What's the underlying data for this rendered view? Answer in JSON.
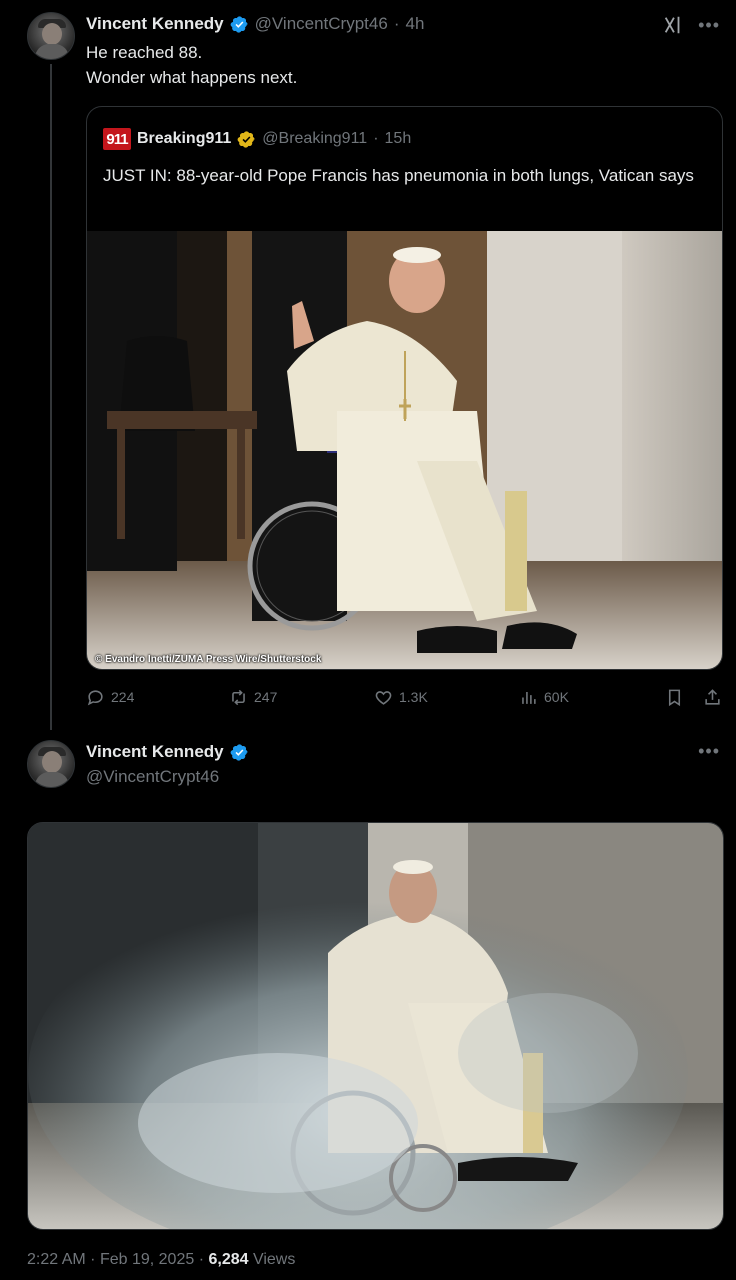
{
  "tweet": {
    "author_name": "Vincent Kennedy",
    "author_handle": "@VincentCrypt46",
    "time_ago": "4h",
    "text_line1": "He reached 88.",
    "text_line2": "Wonder what happens next."
  },
  "quoted": {
    "logo_text": "911",
    "author_name": "Breaking911",
    "author_handle": "@Breaking911",
    "time_ago": "15h",
    "text": "JUST IN: 88-year-old Pope Francis has pneumonia in both lungs, Vatican says",
    "image_credit": "© Evandro Inetti/ZUMA Press Wire/Shutterstock"
  },
  "actions": {
    "replies": "224",
    "reposts": "247",
    "likes": "1.3K",
    "views": "60K"
  },
  "reply": {
    "author_name": "Vincent Kennedy",
    "author_handle": "@VincentCrypt46"
  },
  "footer": {
    "time": "2:22 AM",
    "date": "Feb 19, 2025",
    "views_count": "6,284",
    "views_label": "Views"
  },
  "colors": {
    "verified_blue": "#1d9bf0",
    "gold_badge": "#e2b719",
    "muted": "#71767b",
    "background": "#000000",
    "breaking_red": "#c4161c"
  },
  "icons": [
    "verified-badge-icon",
    "grok-icon",
    "more-icon",
    "reply-icon",
    "repost-icon",
    "like-icon",
    "views-icon",
    "bookmark-icon",
    "share-icon"
  ]
}
